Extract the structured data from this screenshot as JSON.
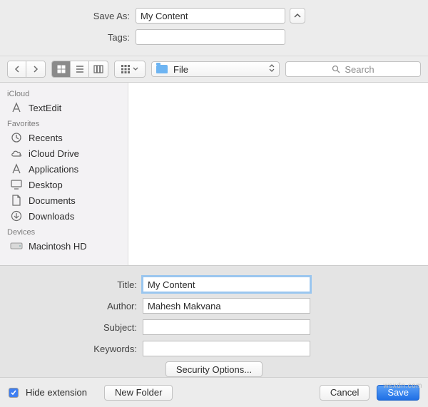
{
  "top": {
    "saveas_label": "Save As:",
    "saveas_value": "My Content",
    "tags_label": "Tags:",
    "tags_value": ""
  },
  "toolbar": {
    "folder_label": "File",
    "search_placeholder": "Search"
  },
  "sidebar": {
    "sections": [
      {
        "title": "iCloud",
        "items": [
          {
            "label": "TextEdit",
            "icon": "textedit-icon"
          }
        ]
      },
      {
        "title": "Favorites",
        "items": [
          {
            "label": "Recents",
            "icon": "recents-icon"
          },
          {
            "label": "iCloud Drive",
            "icon": "icloud-icon"
          },
          {
            "label": "Applications",
            "icon": "applications-icon"
          },
          {
            "label": "Desktop",
            "icon": "desktop-icon"
          },
          {
            "label": "Documents",
            "icon": "documents-icon"
          },
          {
            "label": "Downloads",
            "icon": "downloads-icon"
          }
        ]
      },
      {
        "title": "Devices",
        "items": [
          {
            "label": "Macintosh HD",
            "icon": "disk-icon"
          }
        ]
      }
    ]
  },
  "meta": {
    "title_label": "Title:",
    "title_value": "My Content",
    "author_label": "Author:",
    "author_value": "Mahesh Makvana",
    "subject_label": "Subject:",
    "subject_value": "",
    "keywords_label": "Keywords:",
    "keywords_value": "",
    "security_options_label": "Security Options..."
  },
  "footer": {
    "hide_extension_label": "Hide extension",
    "hide_extension_checked": true,
    "new_folder_label": "New Folder",
    "cancel_label": "Cancel",
    "save_label": "Save"
  },
  "watermark": "wsxdn.com"
}
